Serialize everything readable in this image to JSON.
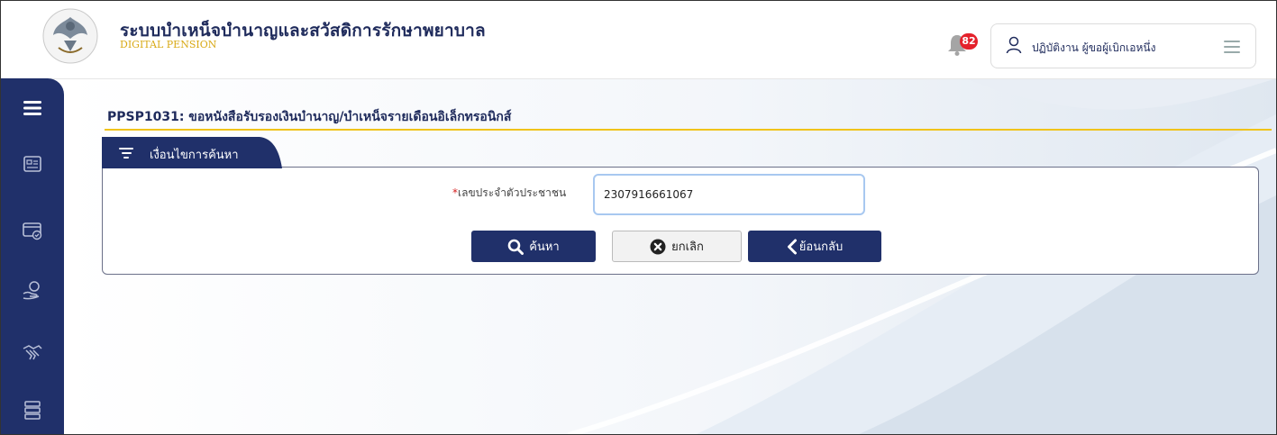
{
  "header": {
    "title_th": "ระบบบำเหน็จบำนาญและสวัสดิการรักษาพยาบาล",
    "title_en": "DIGITAL PENSION",
    "notification_count": "82",
    "user_name": "ปฏิบัติงาน ผู้ขอผู้เบิกเอหนึ่ง"
  },
  "sidebar": {
    "items": [
      {
        "icon": "hamburger-menu-icon"
      },
      {
        "icon": "id-card-icon"
      },
      {
        "icon": "card-check-icon"
      },
      {
        "icon": "hand-money-icon"
      },
      {
        "icon": "handshake-icon"
      },
      {
        "icon": "database-icon"
      }
    ]
  },
  "page": {
    "title": "PPSP1031: ขอหนังสือรับรองเงินบำนาญ/บำเหน็จรายเดือนอิเล็กทรอนิกส์"
  },
  "search_panel": {
    "tab_label": "เงื่อนไขการค้นหา",
    "field_required_mark": "*",
    "field_label": "เลขประจำตัวประชาชน",
    "field_value": "2307916661067"
  },
  "buttons": {
    "search": "ค้นหา",
    "cancel": "ยกเลิก",
    "back": "ย้อนกลับ"
  },
  "colors": {
    "navy": "#20306a",
    "gold": "#f0c31a",
    "badge_red": "#e4212b"
  }
}
